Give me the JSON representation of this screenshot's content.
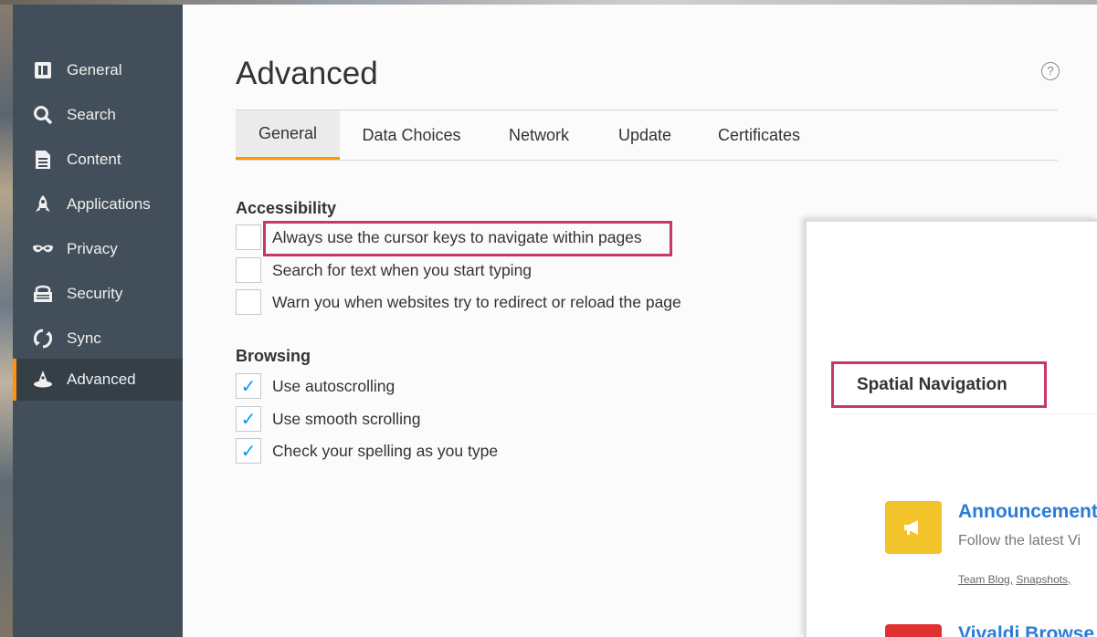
{
  "sidebar": {
    "items": [
      {
        "label": "General",
        "icon": "general-icon"
      },
      {
        "label": "Search",
        "icon": "search-icon"
      },
      {
        "label": "Content",
        "icon": "content-icon"
      },
      {
        "label": "Applications",
        "icon": "applications-icon"
      },
      {
        "label": "Privacy",
        "icon": "privacy-icon"
      },
      {
        "label": "Security",
        "icon": "security-icon"
      },
      {
        "label": "Sync",
        "icon": "sync-icon"
      },
      {
        "label": "Advanced",
        "icon": "advanced-icon",
        "active": true
      }
    ]
  },
  "main": {
    "title": "Advanced",
    "help_icon": "?",
    "tabs": [
      {
        "label": "General",
        "active": true
      },
      {
        "label": "Data Choices"
      },
      {
        "label": "Network"
      },
      {
        "label": "Update"
      },
      {
        "label": "Certificates"
      }
    ],
    "accessibility": {
      "title": "Accessibility",
      "options": [
        {
          "label": "Always use the cursor keys to navigate within pages",
          "checked": false,
          "highlighted": true
        },
        {
          "label": "Search for text when you start typing",
          "checked": false
        },
        {
          "label": "Warn you when websites try to redirect or reload the page",
          "checked": false
        }
      ]
    },
    "browsing": {
      "title": "Browsing",
      "options": [
        {
          "label": "Use autoscrolling",
          "checked": true
        },
        {
          "label": "Use smooth scrolling",
          "checked": true
        },
        {
          "label": "Check your spelling as you type",
          "checked": true
        }
      ]
    },
    "check_glyph": "✓"
  },
  "overlay": {
    "header": "Spatial Navigation",
    "announcement": {
      "title": "Announcement",
      "description": "Follow the latest Vi",
      "links": [
        "Team Blog,",
        "Snapshots,"
      ]
    },
    "vivaldi_title": "Vivaldi Browse"
  },
  "colors": {
    "sidebar_bg": "#424f5a",
    "accent": "#ff9400",
    "checkbox_check": "#0996f8",
    "highlight": "#c7386a",
    "link": "#2b7bd6"
  }
}
